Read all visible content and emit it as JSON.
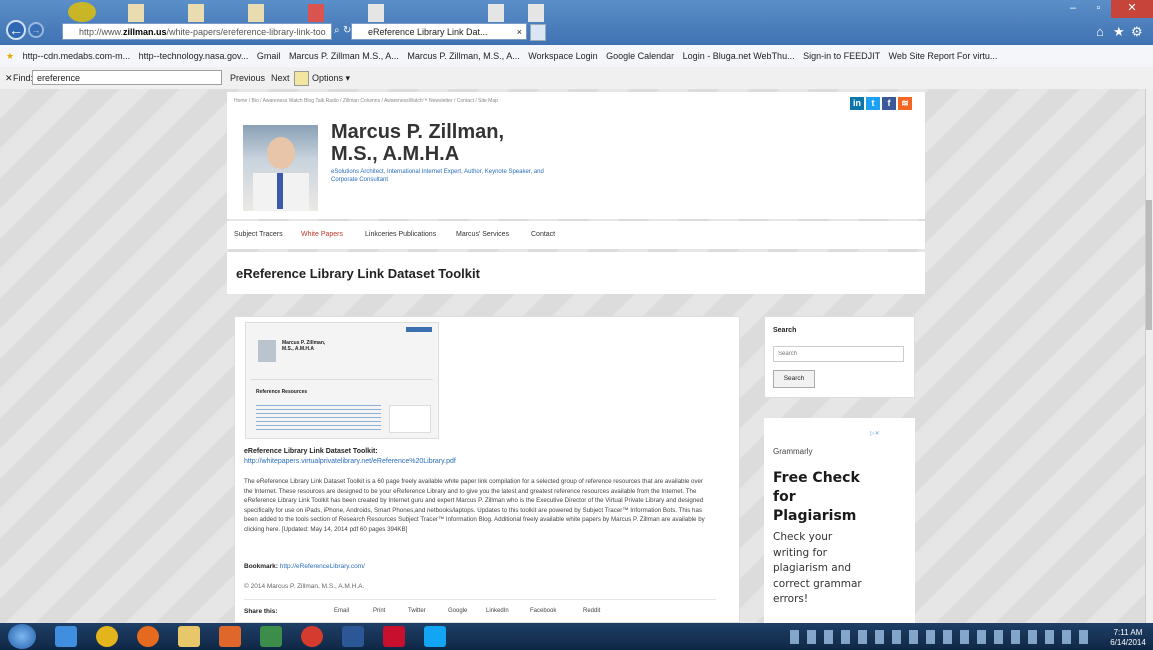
{
  "browser": {
    "address_url_prefix": "http://www.",
    "address_url_host": "zillman.us",
    "address_url_path": "/white-papers/ereference-library-link-too",
    "tab_title": "eReference Library Link Dat...",
    "tab_close": "×",
    "favorites": [
      "http--cdn.medabs.com-m...",
      "http--technology.nasa.gov...",
      "Gmail",
      "Marcus P. Zillman M.S., A...",
      "Marcus P. Zillman, M.S., A...",
      "Workspace Login",
      "Google Calendar",
      "Login - Bluga.net WebThu...",
      "Sign-in to FEEDJIT",
      "Web Site Report For virtu..."
    ],
    "find_label": "Find:",
    "find_value": "ereference",
    "find_prev": "Previous",
    "find_next": "Next",
    "find_options": "Options ▾"
  },
  "site": {
    "top_links": "Home / Bio / Awareness Watch Blog Talk Radio / Zillman Columns / AwarenessWatch™ Newsletter / Contact / Site Map",
    "name_line1": "Marcus P. Zillman,",
    "name_line2": "M.S., A.M.H.A",
    "tagline": "eSolutions Architect, International Internet Expert, Author, Keynote Speaker, and Corporate Consultant",
    "nav": [
      "Subject Tracers",
      "White Papers",
      "Linkceries Publications",
      "Marcus' Services",
      "Contact"
    ],
    "page_title": "eReference Library Link Dataset Toolkit"
  },
  "article": {
    "thumb_name": "Marcus P. Zillman, M.S., A.M.H.A",
    "thumb_heading": "Reference Resources",
    "heading": "eReference Library Link Dataset Toolkit:",
    "pdf_link": "http://whitepapers.virtualprivatelibrary.net/eReference%20Library.pdf",
    "body": "The eReference Library Link Dataset Toolkit is a 60 page freely available white paper link compilation for a selected group of reference resources that are available over the Internet. These resources are designed to be your eReference Library and to give you the latest and greatest reference resources available from the Internet. The eReference Library Link Toolkit has been created by Internet guru and expert Marcus P. Zillman who is the Executive Director of the Virtual Private Library and designed specifically for use on iPads, iPhone, Androids, Smart Phones,and netbooks/laptops. Updates to this toolkit are powered by Subject Tracer™ Information Bots. This has been added to the tools section of Research Resources Subject Tracer™ Information Blog. Additional freely available white papers by Marcus P. Zillman are available by clicking here. [Updated: May 14, 2014 pdf 60 pages 394KB]",
    "bookmark_label": "Bookmark:",
    "bookmark_link": "http://eReferenceLibrary.com/",
    "copyright": "© 2014 Marcus P. Zillman, M.S., A.M.H.A.",
    "share_label": "Share this:",
    "share_buttons": [
      "Email",
      "Print",
      "Twitter",
      "Google",
      "LinkedIn",
      "Facebook",
      "Reddit"
    ]
  },
  "sidebar": {
    "search_title": "Search",
    "search_placeholder": "Search",
    "search_button": "Search",
    "ad_brand": "Grammarly",
    "ad_headline": "Free Check for Plagiarism",
    "ad_body": "Check your writing for plagiarism and correct grammar errors!"
  },
  "taskbar": {
    "time": "7:11 AM",
    "date": "6/14/2014"
  },
  "colors": {
    "link": "#2a6ebb",
    "nav_active": "#c0392b",
    "titlebar": "#4a7fbf",
    "taskbar": "#1a3558"
  }
}
